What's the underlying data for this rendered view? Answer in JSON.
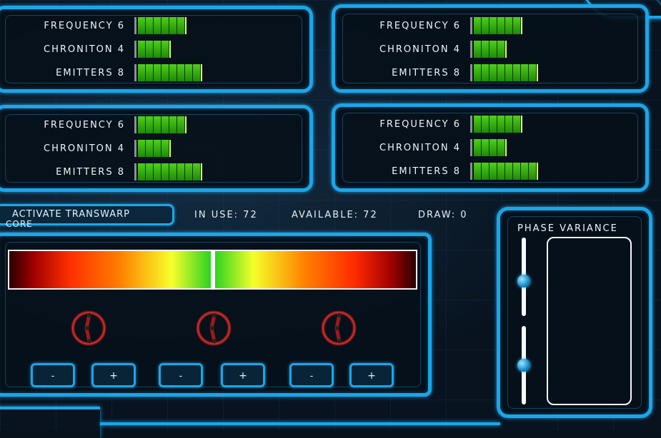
{
  "colors": {
    "accent": "#1aa6e8",
    "bar_green": "#3ab516",
    "bar_cap": "#e6ff3a",
    "background": "#08131f"
  },
  "stat_panels": [
    {
      "rows": [
        {
          "label": "FREQUENCY 6",
          "value": 6
        },
        {
          "label": "CHRONITON 4",
          "value": 4
        },
        {
          "label": "EMITTERS 8",
          "value": 8
        }
      ]
    },
    {
      "rows": [
        {
          "label": "FREQUENCY 6",
          "value": 6
        },
        {
          "label": "CHRONITON 4",
          "value": 4
        },
        {
          "label": "EMITTERS 8",
          "value": 8
        }
      ]
    },
    {
      "rows": [
        {
          "label": "FREQUENCY 6",
          "value": 6
        },
        {
          "label": "CHRONITON 4",
          "value": 4
        },
        {
          "label": "EMITTERS 8",
          "value": 8
        }
      ]
    },
    {
      "rows": [
        {
          "label": "FREQUENCY 6",
          "value": 6
        },
        {
          "label": "CHRONITON 4",
          "value": 4
        },
        {
          "label": "EMITTERS 8",
          "value": 8
        }
      ]
    }
  ],
  "activate_button": {
    "label_line1": "ACTIVATE TRANSWARP",
    "label_line2": "CORE"
  },
  "status": {
    "in_use": "IN USE: 72",
    "available": "AVAILABLE: 72",
    "draw": "DRAW: 0"
  },
  "gradient_marker_fraction": 0.5,
  "controls": [
    {
      "knob": "dial-icon",
      "minus": "-",
      "plus": "+"
    },
    {
      "knob": "dial-icon",
      "minus": "-",
      "plus": "+"
    },
    {
      "knob": "dial-icon",
      "minus": "-",
      "plus": "+"
    }
  ],
  "phase_variance": {
    "title": "PHASE VARIANCE",
    "slider1_level": 0.45,
    "slider2_level": 0.5
  }
}
